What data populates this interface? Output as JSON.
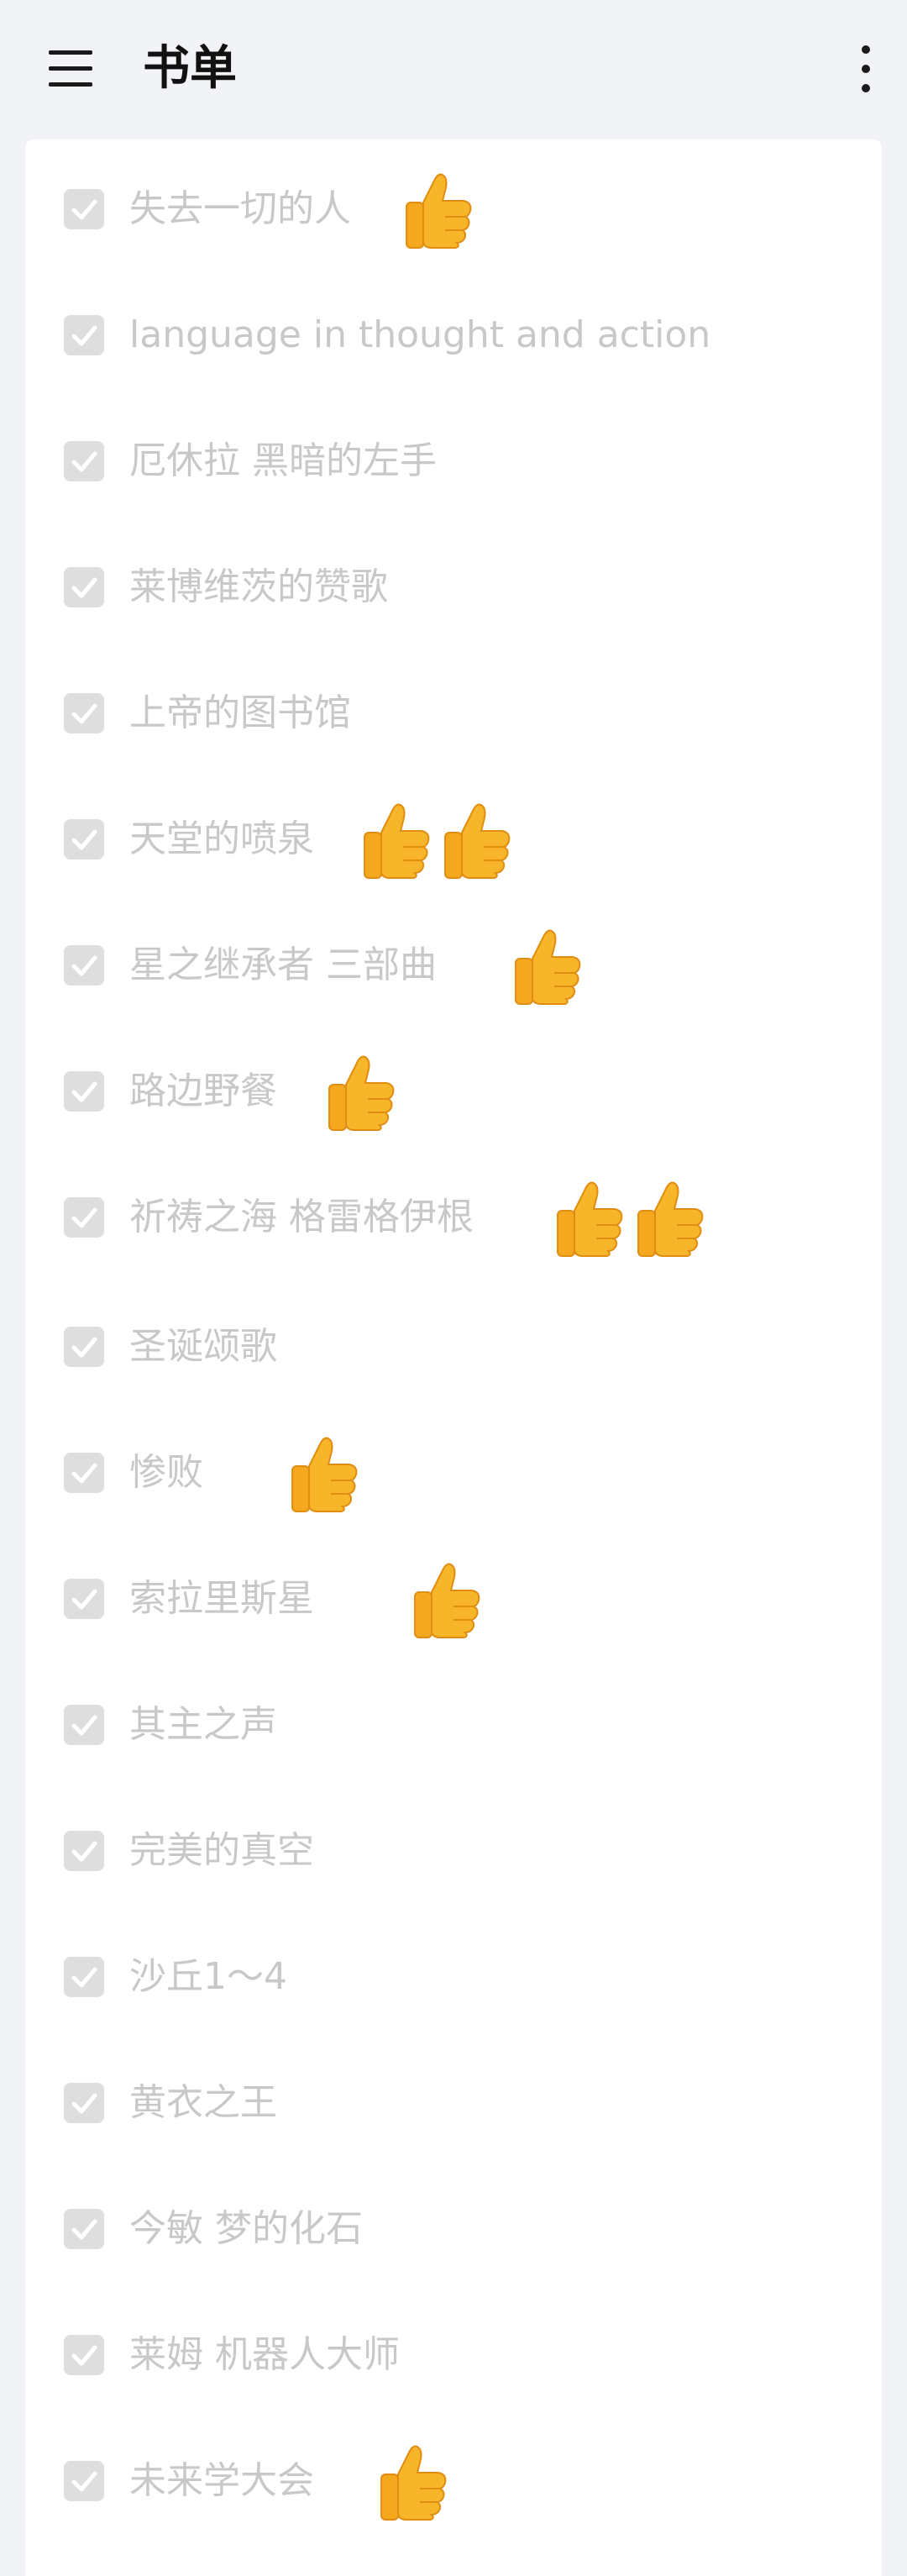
{
  "header": {
    "title": "书单"
  },
  "colors": {
    "background": "#f2f3f7",
    "card": "#ffffff",
    "checkbox": "#dedede",
    "text_completed": "#c8c8c8",
    "thumb_emoji": "#f7b529"
  },
  "icons": {
    "menu": "hamburger-menu-icon",
    "more": "more-vertical-icon",
    "check": "check-icon",
    "thumbs_up": "thumbs-up-emoji"
  },
  "items": [
    {
      "label": "失去一切的人",
      "checked": true,
      "thumbs": 1
    },
    {
      "label": "language in thought and action",
      "checked": true,
      "thumbs": 0
    },
    {
      "label": "厄休拉 黑暗的左手",
      "checked": true,
      "thumbs": 0
    },
    {
      "label": "莱博维茨的赞歌",
      "checked": true,
      "thumbs": 0
    },
    {
      "label": "上帝的图书馆",
      "checked": true,
      "thumbs": 0
    },
    {
      "label": "天堂的喷泉",
      "checked": true,
      "thumbs": 2
    },
    {
      "label": "星之继承者 三部曲",
      "checked": true,
      "thumbs": 1
    },
    {
      "label": "路边野餐",
      "checked": true,
      "thumbs": 1
    },
    {
      "label": "祈祷之海 格雷格伊根",
      "checked": true,
      "thumbs": 2
    },
    {
      "label": "圣诞颂歌",
      "checked": true,
      "thumbs": 0
    },
    {
      "label": "惨败",
      "checked": true,
      "thumbs": 1
    },
    {
      "label": "索拉里斯星",
      "checked": true,
      "thumbs": 1
    },
    {
      "label": "其主之声",
      "checked": true,
      "thumbs": 0
    },
    {
      "label": "完美的真空",
      "checked": true,
      "thumbs": 0
    },
    {
      "label": "沙丘1～4",
      "checked": true,
      "thumbs": 0
    },
    {
      "label": "黄衣之王",
      "checked": true,
      "thumbs": 0
    },
    {
      "label": "今敏 梦的化石",
      "checked": true,
      "thumbs": 0
    },
    {
      "label": "莱姆 机器人大师",
      "checked": true,
      "thumbs": 0
    },
    {
      "label": "未来学大会",
      "checked": true,
      "thumbs": 1
    }
  ]
}
